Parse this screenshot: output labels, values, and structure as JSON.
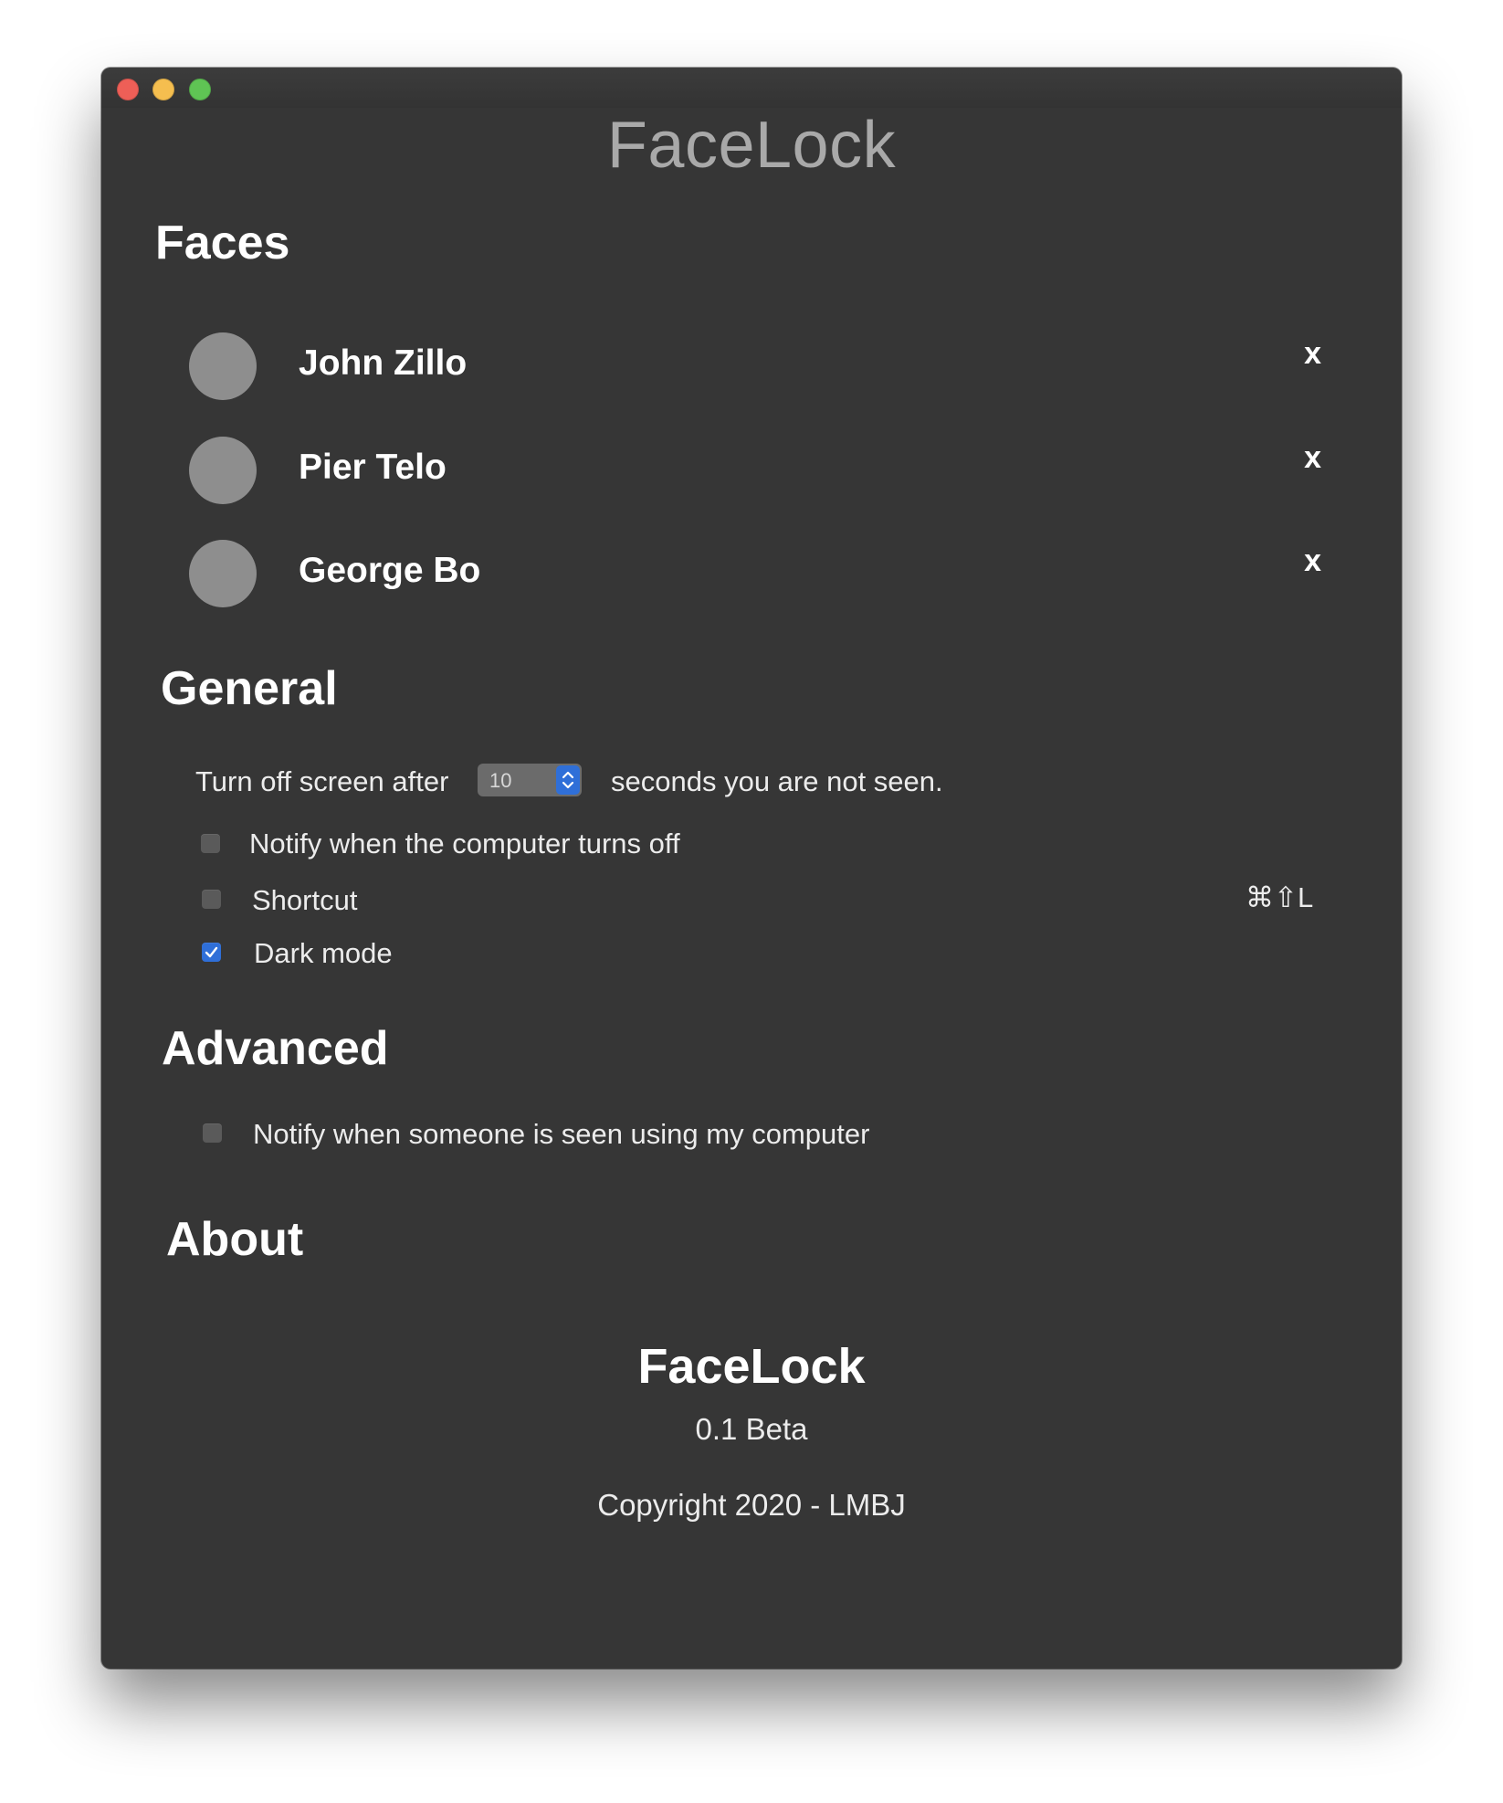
{
  "window": {
    "title": "FaceLock"
  },
  "sections": {
    "faces": "Faces",
    "general": "General",
    "advanced": "Advanced",
    "about": "About"
  },
  "faces": [
    {
      "name": "John Zillo",
      "remove_label": "x"
    },
    {
      "name": "Pier Telo",
      "remove_label": "x"
    },
    {
      "name": "George Bo",
      "remove_label": "x"
    }
  ],
  "general": {
    "screen_off_prefix": "Turn off screen after",
    "screen_off_value": "10",
    "screen_off_suffix": "seconds you are not seen.",
    "notify_off_label": "Notify when the computer turns off",
    "notify_off_checked": false,
    "shortcut_label": "Shortcut",
    "shortcut_checked": false,
    "shortcut_keys": "⌘⇧L",
    "dark_mode_label": "Dark mode",
    "dark_mode_checked": true
  },
  "advanced": {
    "notify_seen_label": "Notify when someone is seen using my computer",
    "notify_seen_checked": false
  },
  "about": {
    "app_name": "FaceLock",
    "version": "0.1 Beta",
    "copyright": "Copyright 2020 - LMBJ"
  },
  "colors": {
    "window_bg": "#363636",
    "accent": "#2f6fd8",
    "avatar": "#8e8e8e",
    "title": "#a9a9a9"
  }
}
